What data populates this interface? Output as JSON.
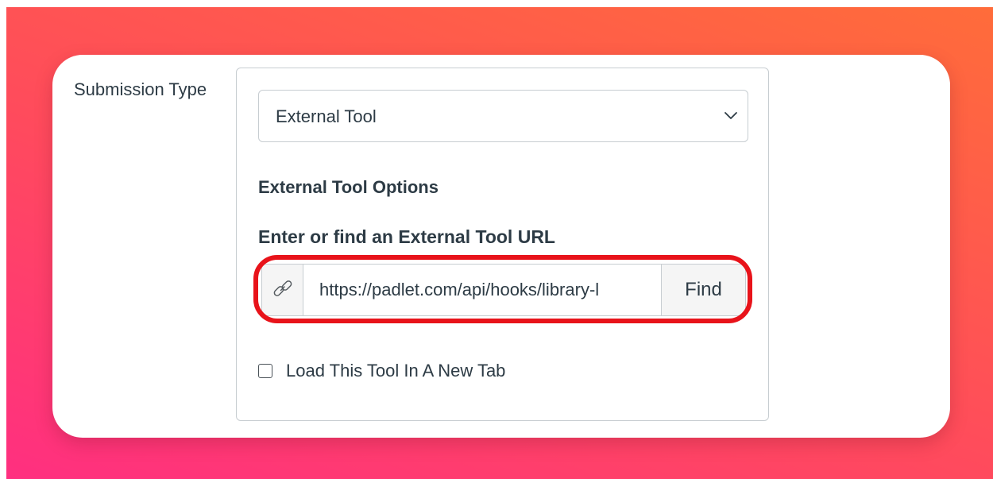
{
  "form": {
    "submission_type_label": "Submission Type",
    "submission_type_select": {
      "selected": "External Tool",
      "icon": "chevron-down-icon"
    },
    "external_tool_options_heading": "External Tool Options",
    "url_field": {
      "label": "Enter or find an External Tool URL",
      "value": "https://padlet.com/api/hooks/library-l",
      "icon": "link-icon",
      "find_button_label": "Find"
    },
    "new_tab_checkbox": {
      "label": "Load This Tool In A New Tab",
      "checked": false
    }
  },
  "colors": {
    "background_gradient": [
      "#ff2f80",
      "#ff4b5c",
      "#ff6c3a"
    ],
    "highlight": "#e8131a",
    "text": "#2d3b45",
    "border": "#c7cdd1"
  }
}
